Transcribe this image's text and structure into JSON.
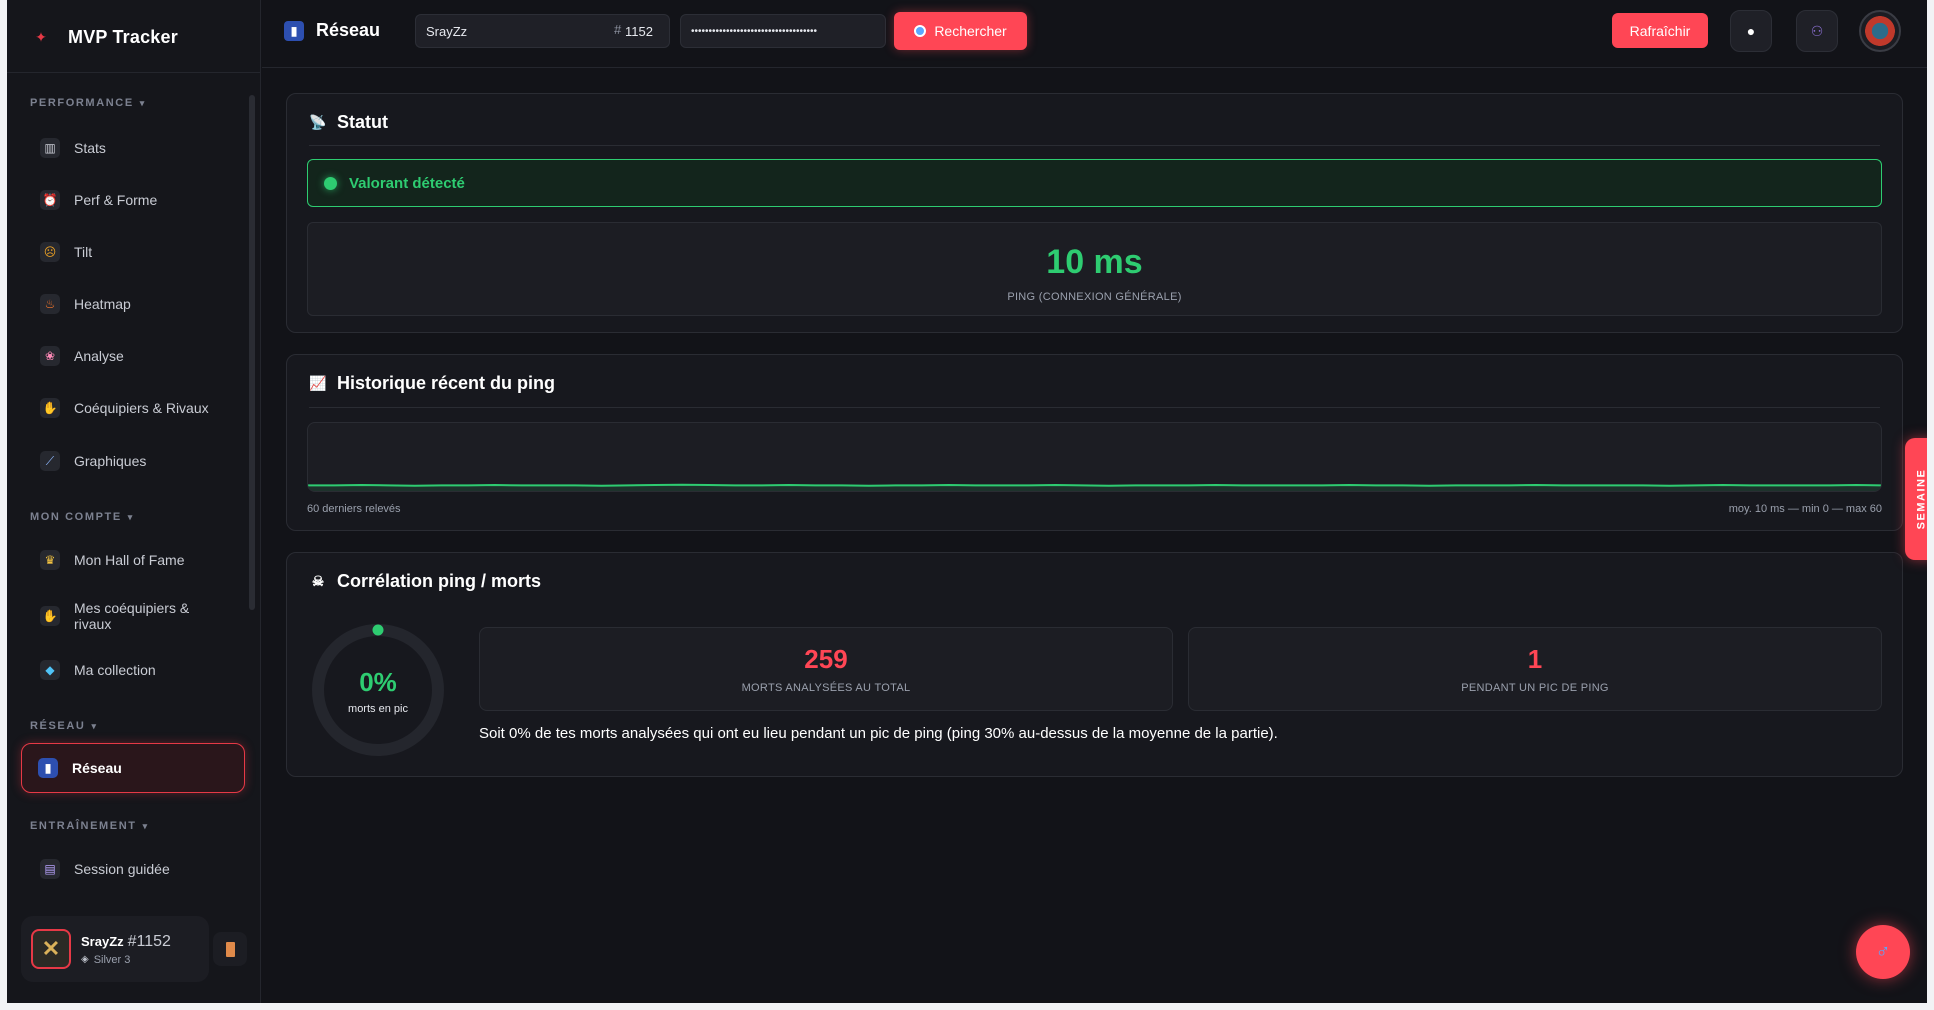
{
  "brand": {
    "name": "MVP Tracker"
  },
  "sidebar": {
    "sections": [
      {
        "label": "PERFORMANCE"
      },
      {
        "label": "MON COMPTE"
      },
      {
        "label": "RÉSEAU"
      },
      {
        "label": "ENTRAÎNEMENT"
      }
    ],
    "items": [
      {
        "label": "Stats",
        "icon": "bar-chart-icon"
      },
      {
        "label": "Perf & Forme",
        "icon": "alarm-clock-icon"
      },
      {
        "label": "Tilt",
        "icon": "angry-face-icon"
      },
      {
        "label": "Heatmap",
        "icon": "fire-icon"
      },
      {
        "label": "Analyse",
        "icon": "brain-icon"
      },
      {
        "label": "Coéquipiers & Rivaux",
        "icon": "handshake-icon"
      },
      {
        "label": "Graphiques",
        "icon": "line-chart-icon"
      },
      {
        "label": "Mon Hall of Fame",
        "icon": "trophy-icon"
      },
      {
        "label": "Mes coéquipiers & rivaux",
        "icon": "handshake-icon"
      },
      {
        "label": "Ma collection",
        "icon": "diamond-icon"
      },
      {
        "label": "Réseau",
        "icon": "signal-bars-icon",
        "active": true
      },
      {
        "label": "Session guidée",
        "icon": "clapper-icon"
      }
    ]
  },
  "profile": {
    "name": "SrayZz",
    "tag": "#1152",
    "rank": "Silver 3"
  },
  "topbar": {
    "title": "Réseau",
    "riot_name": "SrayZz",
    "hash": "#",
    "riot_tag": "1152",
    "api_key_masked": "••••••••••••••••••••••••••••••••••••",
    "search_label": "Rechercher",
    "refresh_label": "Rafraîchir"
  },
  "status": {
    "title": "Statut",
    "detected": "Valorant détecté",
    "ping_value": "10 ms",
    "ping_label": "PING (CONNEXION GÉNÉRALE)"
  },
  "history": {
    "title": "Historique récent du ping",
    "footer_left": "60 derniers relevés",
    "footer_right": "moy. 10 ms — min 0 — max 60",
    "chart_data": {
      "type": "line",
      "ylim": [
        0,
        60
      ],
      "series": [
        {
          "values": [
            10,
            10,
            11,
            10,
            9,
            10,
            10,
            11,
            10,
            10,
            10,
            9,
            10,
            11,
            12,
            11,
            10,
            10,
            11,
            10,
            10,
            9,
            10,
            10,
            11,
            10,
            10,
            10,
            11,
            10,
            9,
            10,
            10,
            10,
            11,
            10,
            10,
            10,
            10,
            11,
            10,
            10,
            9,
            10,
            10,
            10,
            11,
            10,
            10,
            10,
            10,
            9,
            10,
            11,
            10,
            10,
            10,
            10,
            11,
            10
          ]
        }
      ],
      "color": "#2ecc71"
    }
  },
  "correlation": {
    "title": "Corrélation ping / morts",
    "ring_value": "0%",
    "ring_fraction": 0,
    "ring_label": "morts en pic",
    "deaths_total": "259",
    "deaths_total_label": "MORTS ANALYSÉES AU TOTAL",
    "deaths_peak": "1",
    "deaths_peak_label": "PENDANT UN PIC DE PING",
    "summary": "Soit 0% de tes morts analysées qui ont eu lieu pendant un pic de ping (ping 30% au-dessus de la moyenne de la partie)."
  },
  "side_tab": {
    "label": "SEMAINE"
  },
  "colors": {
    "accent": "#ff4655",
    "success": "#2ecc71",
    "background": "#121318"
  }
}
